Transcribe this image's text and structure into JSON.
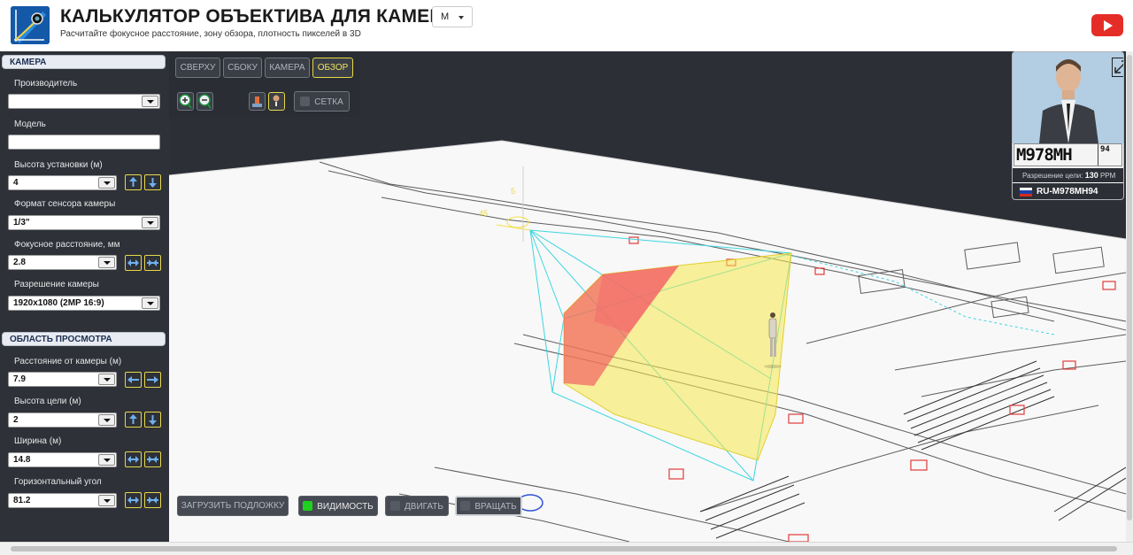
{
  "header": {
    "title": "КАЛЬКУЛЯТОР ОБЪЕКТИВА ДЛЯ КАМЕР",
    "subtitle": "Расчитайте фокусное расстояние, зону обзора, плотность пикселей в 3D",
    "unit": "M"
  },
  "camera": {
    "section_title": "КАМЕРА",
    "manufacturer_label": "Производитель",
    "manufacturer_value": "",
    "model_label": "Модель",
    "model_value": "",
    "height_label": "Высота установки (м)",
    "height_value": "4",
    "sensor_label": "Формат сенсора камеры",
    "sensor_value": "1/3\"",
    "focal_label": "Фокусное расстояние, мм",
    "focal_value": "2.8",
    "resolution_label": "Разрешение камеры",
    "resolution_value": "1920x1080 (2MP 16:9)"
  },
  "view_area": {
    "section_title": "ОБЛАСТЬ ПРОСМОТРА",
    "distance_label": "Расстояние от камеры (м)",
    "distance_value": "7.9",
    "target_height_label": "Высота цели (м)",
    "target_height_value": "2",
    "width_label": "Ширина (м)",
    "width_value": "14.8",
    "hangle_label": "Горизонтальный угол",
    "hangle_value": "81.2"
  },
  "toolbar": {
    "view_top": "СВЕРХУ",
    "view_side": "СБОКУ",
    "view_camera": "КАМЕРА",
    "view_overview": "ОБЗОР",
    "grid": "СЕТКА"
  },
  "bottom_toolbar": {
    "load_background": "ЗАГРУЗИТЬ ПОДЛОЖКУ",
    "visibility": "ВИДИМОСТЬ",
    "move": "ДВИГАТЬ",
    "rotate": "ВРАЩАТЬ"
  },
  "scene": {
    "label_height": "5",
    "label_angle": "45"
  },
  "plate_preview": {
    "plate_text": "M978MH",
    "plate_region": "94",
    "resolution_label": "Разрешение цели:",
    "resolution_value": "130",
    "resolution_unit": "PPM",
    "plate_id": "RU-M978MH94"
  },
  "colors": {
    "panel_bg": "#2e3138",
    "accent_yellow": "#e8d84a",
    "fov_red": "#f04a5a",
    "fov_yellow": "#f5e84a",
    "frustum_cyan": "#3dd6e0"
  }
}
